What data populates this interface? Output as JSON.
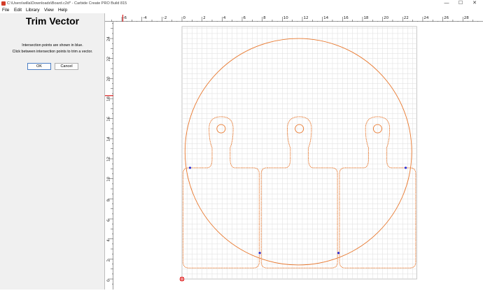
{
  "window": {
    "title": "C:\\Users\\willa\\Downloads\\Board.c2d* - Carbide Create PRO Build 815",
    "minimize_glyph": "—",
    "maximize_glyph": "☐",
    "close_glyph": "✕"
  },
  "menu": [
    "File",
    "Edit",
    "Library",
    "View",
    "Help"
  ],
  "panel": {
    "title": "Trim Vector",
    "message1": "Intersection points are shown in blue.",
    "message2": "Click between intersection points to trim a vector.",
    "ok_label": "OK",
    "cancel_label": "Cancel"
  },
  "rulers": {
    "h_labels": [
      "-6",
      "-4",
      "-2",
      "0",
      "2",
      "4",
      "6",
      "8",
      "10",
      "12",
      "14",
      "16",
      "18",
      "20",
      "22",
      "24",
      "26",
      "28"
    ],
    "v_labels": [
      "24",
      "22",
      "20",
      "18",
      "16",
      "14",
      "12",
      "10",
      "8",
      "6",
      "4",
      "2",
      "0"
    ]
  },
  "colors": {
    "vector": "#e8782e",
    "intersection": "#2a2fd8",
    "grid": "#dedede",
    "ruler_marker": "#d81e1e"
  },
  "icons": {
    "origin": "origin-icon"
  }
}
